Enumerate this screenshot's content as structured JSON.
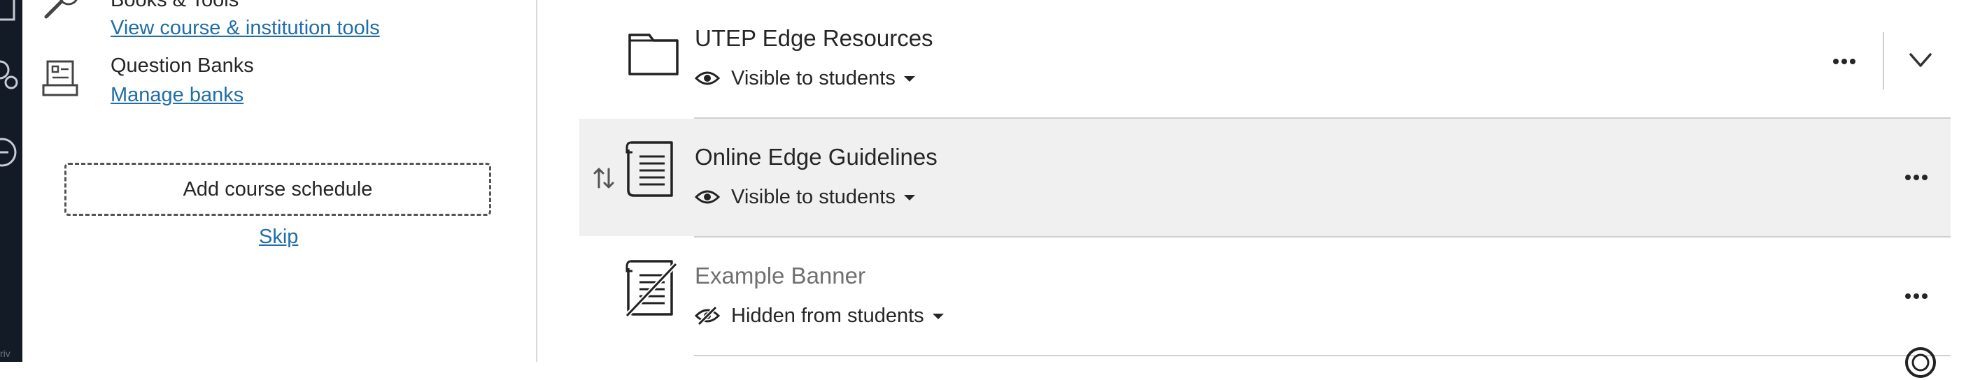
{
  "rail": {
    "bottom_text": "riv"
  },
  "left_panel": {
    "books_tools": {
      "title": "Books & Tools",
      "link": "View course & institution tools",
      "icon": "wrench-icon"
    },
    "question_banks": {
      "title": "Question Banks",
      "link": "Manage banks",
      "icon": "question-bank-icon"
    },
    "add_schedule_label": "Add course schedule",
    "skip_label": "Skip"
  },
  "content_items": [
    {
      "title": "UTEP Edge Resources",
      "type": "folder",
      "icon": "folder-icon",
      "visibility": "Visible to students",
      "expandable": true
    },
    {
      "title": "Online Edge Guidelines",
      "type": "document",
      "icon": "document-icon",
      "visibility": "Visible to students",
      "highlighted": true
    },
    {
      "title": "Example Banner",
      "type": "document",
      "icon": "document-hidden-icon",
      "visibility": "Hidden from students",
      "hidden": true
    }
  ],
  "colors": {
    "link": "#1f6ea8",
    "rail": "#131b26",
    "hover_row": "#f0f0f0",
    "hidden_text": "#707070",
    "text": "#262626"
  }
}
